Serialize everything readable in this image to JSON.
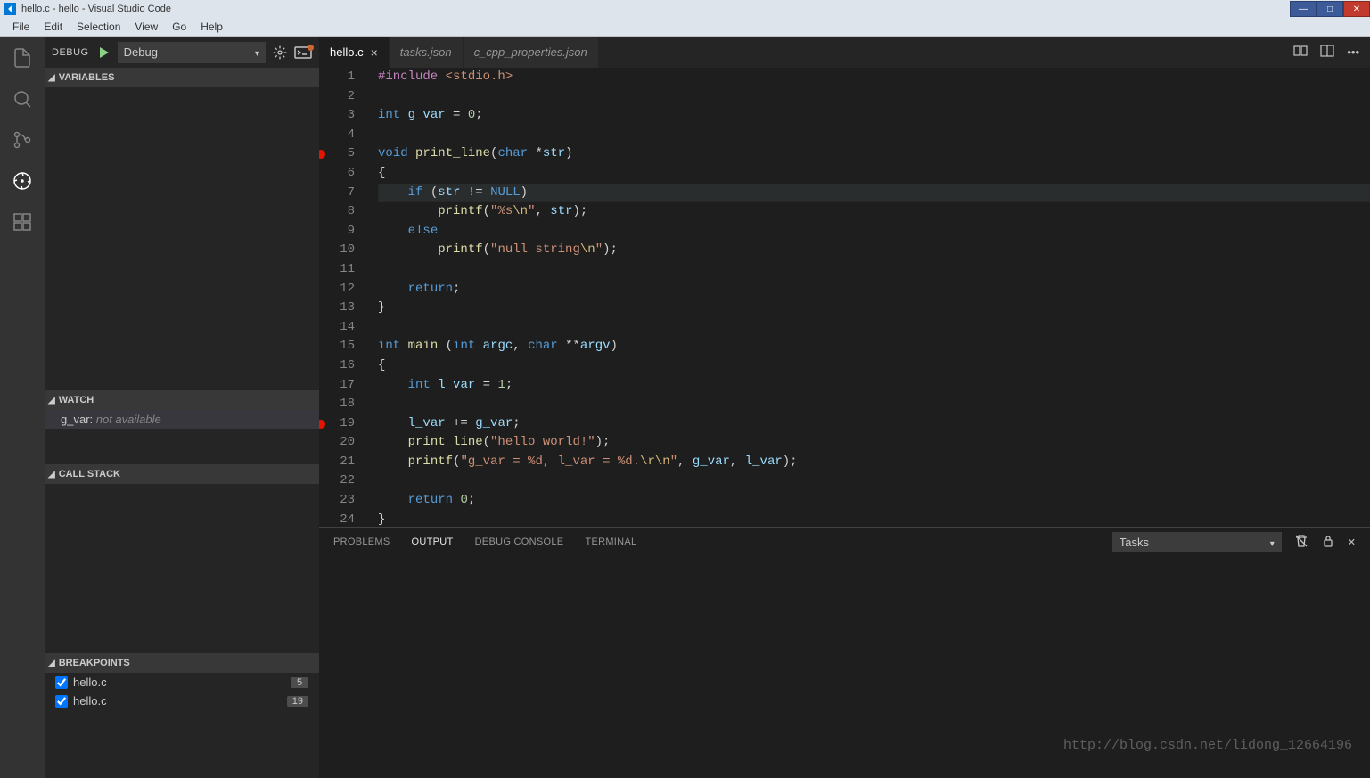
{
  "window": {
    "title": "hello.c - hello - Visual Studio Code"
  },
  "menu": {
    "file": "File",
    "edit": "Edit",
    "selection": "Selection",
    "view": "View",
    "go": "Go",
    "help": "Help"
  },
  "debug": {
    "label": "DEBUG",
    "config": "Debug"
  },
  "sections": {
    "variables": "VARIABLES",
    "watch": "WATCH",
    "callstack": "CALL STACK",
    "breakpoints": "BREAKPOINTS"
  },
  "watch": {
    "expr": "g_var:",
    "val": " not available"
  },
  "breakpoints": [
    {
      "file": "hello.c",
      "line": "5"
    },
    {
      "file": "hello.c",
      "line": "19"
    }
  ],
  "tabs": [
    {
      "name": "hello.c",
      "active": true
    },
    {
      "name": "tasks.json",
      "active": false
    },
    {
      "name": "c_cpp_properties.json",
      "active": false
    }
  ],
  "panel": {
    "problems": "PROBLEMS",
    "output": "OUTPUT",
    "debug_console": "DEBUG CONSOLE",
    "terminal": "TERMINAL",
    "select": "Tasks"
  },
  "watermark": "http://blog.csdn.net/lidong_12664196",
  "code": {
    "breakpoint_lines": [
      5,
      19
    ],
    "current_line": 7,
    "lines": [
      [
        [
          "inc",
          "#include"
        ],
        [
          "pn",
          " "
        ],
        [
          "str",
          "<stdio.h>"
        ]
      ],
      [],
      [
        [
          "kw",
          "int"
        ],
        [
          "pn",
          " "
        ],
        [
          "id",
          "g_var"
        ],
        [
          "pn",
          " = "
        ],
        [
          "num",
          "0"
        ],
        [
          "pn",
          ";"
        ]
      ],
      [],
      [
        [
          "kw",
          "void"
        ],
        [
          "pn",
          " "
        ],
        [
          "fn",
          "print_line"
        ],
        [
          "pn",
          "("
        ],
        [
          "kw",
          "char"
        ],
        [
          "pn",
          " *"
        ],
        [
          "id",
          "str"
        ],
        [
          "pn",
          ")"
        ]
      ],
      [
        [
          "pn",
          "{"
        ]
      ],
      [
        [
          "pn",
          "    "
        ],
        [
          "kw",
          "if"
        ],
        [
          "pn",
          " ("
        ],
        [
          "id",
          "str"
        ],
        [
          "pn",
          " != "
        ],
        [
          "const",
          "NULL"
        ],
        [
          "pn",
          ")"
        ]
      ],
      [
        [
          "pn",
          "        "
        ],
        [
          "fn",
          "printf"
        ],
        [
          "pn",
          "("
        ],
        [
          "str",
          "\"%s"
        ],
        [
          "esc",
          "\\n"
        ],
        [
          "str",
          "\""
        ],
        [
          "pn",
          ", "
        ],
        [
          "id",
          "str"
        ],
        [
          "pn",
          ");"
        ]
      ],
      [
        [
          "pn",
          "    "
        ],
        [
          "kw",
          "else"
        ]
      ],
      [
        [
          "pn",
          "        "
        ],
        [
          "fn",
          "printf"
        ],
        [
          "pn",
          "("
        ],
        [
          "str",
          "\"null string"
        ],
        [
          "esc",
          "\\n"
        ],
        [
          "str",
          "\""
        ],
        [
          "pn",
          ");"
        ]
      ],
      [],
      [
        [
          "pn",
          "    "
        ],
        [
          "kw",
          "return"
        ],
        [
          "pn",
          ";"
        ]
      ],
      [
        [
          "pn",
          "}"
        ]
      ],
      [],
      [
        [
          "kw",
          "int"
        ],
        [
          "pn",
          " "
        ],
        [
          "fn",
          "main"
        ],
        [
          "pn",
          " ("
        ],
        [
          "kw",
          "int"
        ],
        [
          "pn",
          " "
        ],
        [
          "id",
          "argc"
        ],
        [
          "pn",
          ", "
        ],
        [
          "kw",
          "char"
        ],
        [
          "pn",
          " **"
        ],
        [
          "id",
          "argv"
        ],
        [
          "pn",
          ")"
        ]
      ],
      [
        [
          "pn",
          "{"
        ]
      ],
      [
        [
          "pn",
          "    "
        ],
        [
          "kw",
          "int"
        ],
        [
          "pn",
          " "
        ],
        [
          "id",
          "l_var"
        ],
        [
          "pn",
          " = "
        ],
        [
          "num",
          "1"
        ],
        [
          "pn",
          ";"
        ]
      ],
      [],
      [
        [
          "pn",
          "    "
        ],
        [
          "id",
          "l_var"
        ],
        [
          "pn",
          " += "
        ],
        [
          "id",
          "g_var"
        ],
        [
          "pn",
          ";"
        ]
      ],
      [
        [
          "pn",
          "    "
        ],
        [
          "fn",
          "print_line"
        ],
        [
          "pn",
          "("
        ],
        [
          "str",
          "\"hello world!\""
        ],
        [
          "pn",
          ");"
        ]
      ],
      [
        [
          "pn",
          "    "
        ],
        [
          "fn",
          "printf"
        ],
        [
          "pn",
          "("
        ],
        [
          "str",
          "\"g_var = %d, l_var = %d."
        ],
        [
          "esc",
          "\\r\\n"
        ],
        [
          "str",
          "\""
        ],
        [
          "pn",
          ", "
        ],
        [
          "id",
          "g_var"
        ],
        [
          "pn",
          ", "
        ],
        [
          "id",
          "l_var"
        ],
        [
          "pn",
          ");"
        ]
      ],
      [],
      [
        [
          "pn",
          "    "
        ],
        [
          "kw",
          "return"
        ],
        [
          "pn",
          " "
        ],
        [
          "num",
          "0"
        ],
        [
          "pn",
          ";"
        ]
      ],
      [
        [
          "pn",
          "}"
        ]
      ]
    ]
  }
}
